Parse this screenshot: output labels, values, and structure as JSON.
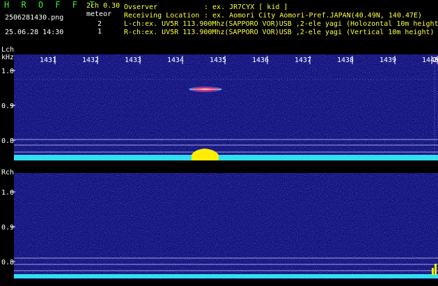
{
  "app": {
    "title": "H R O F F T",
    "version": "2ch 0.30",
    "filename": "2506281430.png",
    "datetime": "25.06.28 14:30"
  },
  "meteor": {
    "label": "meteor",
    "lch_count": "2",
    "rch_count": "1"
  },
  "info": {
    "observer_label": "Ovserver",
    "observer_value": ": ex. JR7CYX [ kid ]",
    "location_label": "Receiving Location",
    "location_value": ": ex. Aomori City Aomori-Pref.JAPAN(40.49N, 140.47E)",
    "lch": "L-ch:ex. UV5R 113.900Mhz(SAPPORO VOR)USB ,2-ele yagi (Holozontal 10m height)",
    "rch": "R-ch:ex. UV5R 113.900Mhz(SAPPORO VOR)USB ,2-ele yagi (Vertical 10m height)"
  },
  "time_axis": [
    "1431",
    "1432",
    "1433",
    "1434",
    "1435",
    "1436",
    "1437",
    "1438",
    "1439",
    "1440",
    "2"
  ],
  "lch": {
    "channel_label": "Lch",
    "unit_label": "kHz",
    "y_ticks": [
      "1.0",
      "0.9",
      "0.8"
    ]
  },
  "rch": {
    "channel_label": "Rch",
    "y_ticks": [
      "1.0",
      "0.9",
      "0.8"
    ]
  },
  "colors": {
    "background": "#000000",
    "spectrogram": "#0a0a6e",
    "title_green": "#3cf03c",
    "text_yellow": "#ffff40",
    "level_cyan": "#30e0f0",
    "echo_yellow": "#ffee00",
    "echo_red": "#e0205a"
  }
}
